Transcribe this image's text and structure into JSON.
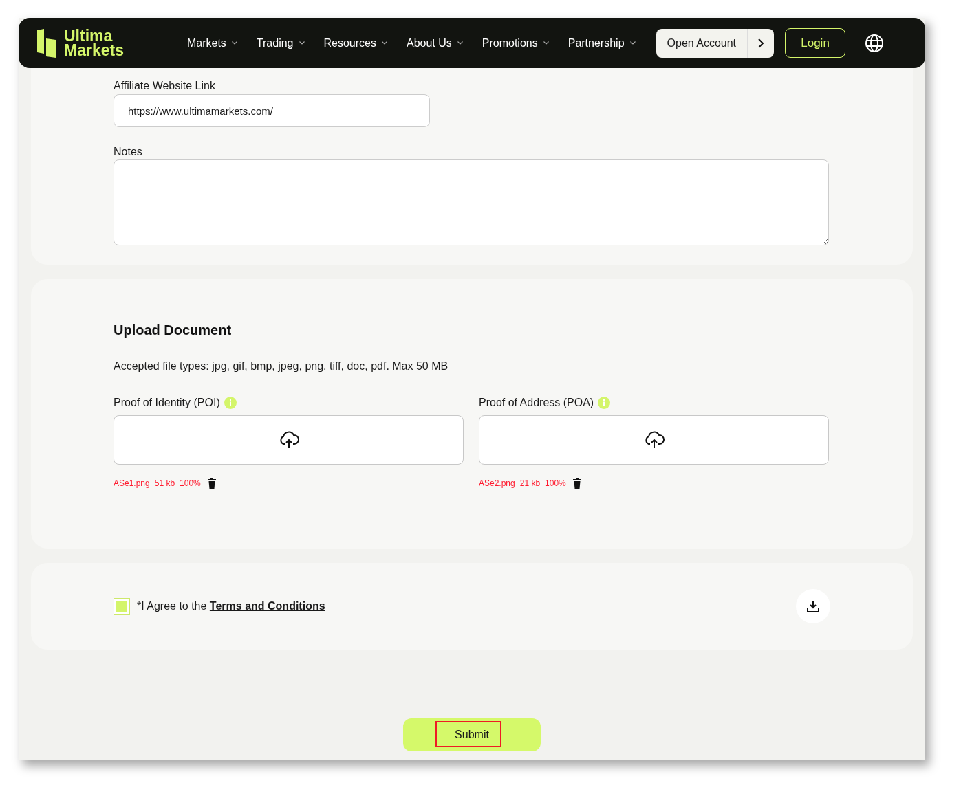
{
  "header": {
    "logo_lines": [
      "Ultima",
      "Markets"
    ],
    "nav": [
      {
        "label": "Markets"
      },
      {
        "label": "Trading"
      },
      {
        "label": "Resources"
      },
      {
        "label": "About Us"
      },
      {
        "label": "Promotions"
      },
      {
        "label": "Partnership"
      }
    ],
    "open_account": "Open Account",
    "login": "Login"
  },
  "details": {
    "affiliate_label": "Affiliate Website Link",
    "affiliate_value": "https://www.ultimamarkets.com/",
    "notes_label": "Notes"
  },
  "upload": {
    "title": "Upload Document",
    "accepted": "Accepted file types: jpg, gif, bmp, jpeg, png, tiff, doc, pdf. Max 50 MB",
    "slots": [
      {
        "label": "Proof of Identity (POI)",
        "file": {
          "name": "ASe1.png",
          "size": "51 kb",
          "progress": "100%"
        }
      },
      {
        "label": "Proof of Address (POA)",
        "file": {
          "name": "ASe2.png",
          "size": "21 kb",
          "progress": "100%"
        }
      }
    ]
  },
  "agreement": {
    "checked": true,
    "text": "*I Agree to the ",
    "link": "Terms and Conditions"
  },
  "submit": {
    "label": "Submit",
    "highlighted": true
  }
}
